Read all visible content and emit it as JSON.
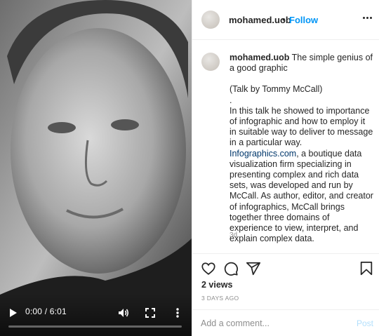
{
  "video": {
    "time": "0:00 / 6:01",
    "progress": 0.0,
    "play_icon": "play-icon",
    "volume_icon": "volume-icon",
    "fullscreen_icon": "fullscreen-icon",
    "more_icon": "more-vertical-icon"
  },
  "header": {
    "username": "mohamed.uob",
    "separator": "•",
    "follow_label": "Follow",
    "options_icon": "more-horizontal-icon"
  },
  "caption": {
    "username": "mohamed.uob",
    "title": " The simple genius of a good graphic",
    "talk_by": "(Talk by Tommy McCall)",
    "dot": ".",
    "body1": "In this talk he showed to importance of infographic and how to employ it in suitable way to deliver to message in a particular way.",
    "link": "Infographics.com",
    "body2": ", a boutique data visualization firm specializing in presenting complex and rich data sets, was developed and run by McCall. As author, editor, and creator of infographics, McCall brings together three domains of experience to view, interpret, and explain complex data.",
    "age": "3d"
  },
  "actions": {
    "like_icon": "heart-icon",
    "comment_icon": "comment-icon",
    "share_icon": "send-icon",
    "save_icon": "bookmark-icon",
    "views": "2 views",
    "date": "3 DAYS AGO"
  },
  "comment_box": {
    "placeholder": "Add a comment...",
    "post_label": "Post"
  },
  "colors": {
    "accent": "#0095f6",
    "link": "#00376b",
    "muted": "#8e8e8e",
    "post_disabled": "#b2dffc"
  }
}
